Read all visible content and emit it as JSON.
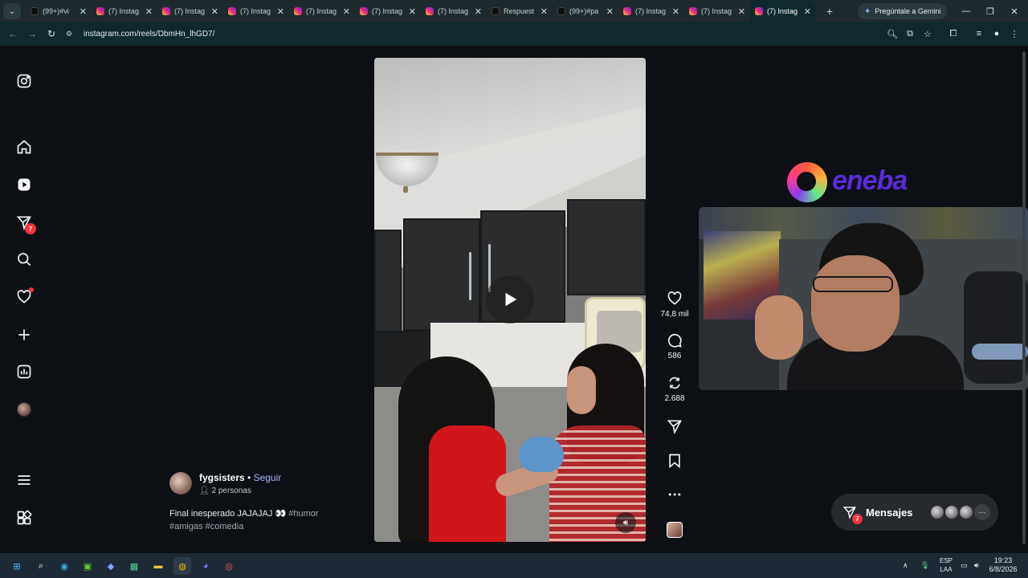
{
  "browser": {
    "tabs": [
      {
        "title": "(99+)#vi",
        "favicon": "tiktok-icon",
        "active": false
      },
      {
        "title": "(7) Instag",
        "favicon": "instagram-icon",
        "active": false
      },
      {
        "title": "(7) Instag",
        "favicon": "instagram-icon",
        "active": false
      },
      {
        "title": "(7) Instag",
        "favicon": "instagram-icon",
        "active": false
      },
      {
        "title": "(7) Instag",
        "favicon": "instagram-icon",
        "active": false
      },
      {
        "title": "(7) Instag",
        "favicon": "instagram-icon",
        "active": false
      },
      {
        "title": "(7) Instag",
        "favicon": "instagram-icon",
        "active": false
      },
      {
        "title": "Respuest",
        "favicon": "tiktok-icon",
        "active": false
      },
      {
        "title": "(99+)#pa",
        "favicon": "tiktok-icon",
        "active": false
      },
      {
        "title": "(7) Instag",
        "favicon": "instagram-icon",
        "active": false
      },
      {
        "title": "(7) Instag",
        "favicon": "instagram-icon",
        "active": false
      },
      {
        "title": "(7) Instag",
        "favicon": "instagram-icon",
        "active": true
      }
    ],
    "new_tab": "+",
    "gemini_label": "Pregúntale a Gemini",
    "url": "instagram.com/reels/DbmHn_lhGD7/"
  },
  "instagram": {
    "nav_badges": {
      "messages": "7"
    },
    "reel": {
      "username": "fygsisters",
      "separator": " • ",
      "follow_label": "Seguir",
      "people": "2 personas",
      "caption_text": "Final inesperado JAJAJAJ 👀",
      "tags_line1": "#humor",
      "tags_line2": "#amigas #comedia"
    },
    "actions": {
      "likes": "74,8 mil",
      "comments": "586",
      "reposts": "2.688"
    },
    "messages": {
      "label": "Mensajes",
      "badge": "7",
      "more": "···"
    }
  },
  "overlay": {
    "sponsor": "eneba"
  },
  "taskbar": {
    "lang_line1": "ESP",
    "lang_line2": "LAA",
    "time": "19:23",
    "date": "6/8/2026"
  }
}
